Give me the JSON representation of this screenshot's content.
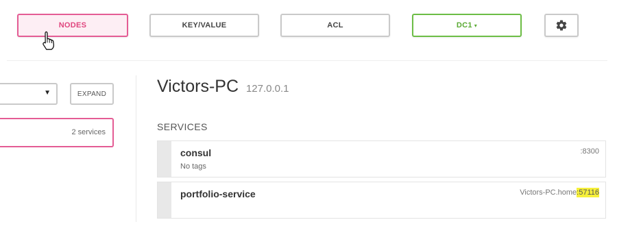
{
  "nav": {
    "nodes": "NODES",
    "keyvalue": "KEY/VALUE",
    "acl": "ACL",
    "dc": "DC1",
    "dc_caret": "▾",
    "settings_icon": "gear-icon"
  },
  "sidebar": {
    "select_value": "",
    "select_arrow": "▼",
    "expand_label": "EXPAND",
    "node_services": "2 services"
  },
  "node": {
    "name": "Victors-PC",
    "address": "127.0.0.1",
    "services_label": "SERVICES",
    "services": [
      {
        "name": "consul",
        "tags": "No tags",
        "port": ":8300"
      },
      {
        "name": "portfolio-service",
        "tags": "",
        "host": "Victors-PC.home",
        "port": ":57116"
      }
    ]
  },
  "colors": {
    "active_nav": "#e45c94",
    "dc_green": "#6cbd45",
    "highlight": "#f6f03a"
  }
}
